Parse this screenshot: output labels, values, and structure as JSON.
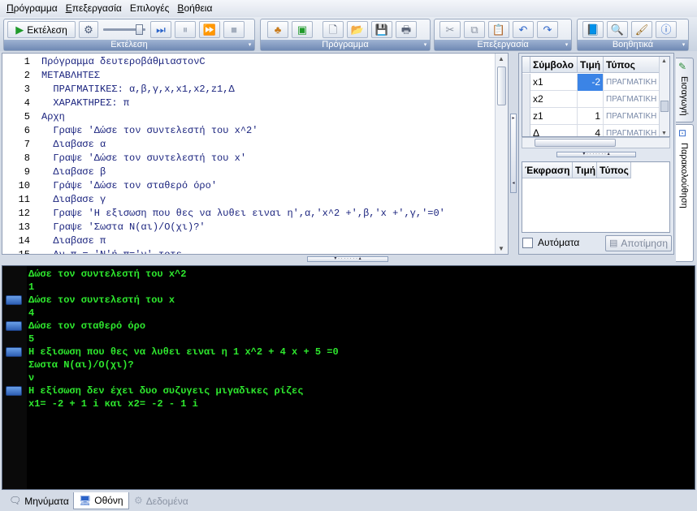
{
  "menu": {
    "items": [
      {
        "u": "Π",
        "rest": "ρόγραμμα"
      },
      {
        "u": "Ε",
        "rest": "πεξεργασία"
      },
      {
        "u": "",
        "rest": "Επιλογές",
        "u2": "λ"
      },
      {
        "u": "Β",
        "rest": "οήθεια"
      }
    ]
  },
  "toolbar": {
    "run_group": {
      "caption": "Εκτέλεση",
      "run_label": "Εκτέλεση"
    },
    "program_group": {
      "caption": "Πρόγραμμα"
    },
    "edit_group": {
      "caption": "Επεξεργασία"
    },
    "help_group": {
      "caption": "Βοηθητικά"
    }
  },
  "editor": {
    "lines": [
      {
        "n": "1",
        "text": "Πρόγραμμα δευτεροβάθμιαστονC"
      },
      {
        "n": "2",
        "text": "ΜΕΤΑΒΛΗΤΕΣ"
      },
      {
        "n": "3",
        "text": "  ΠΡΑΓΜΑΤΙΚΕΣ: α,β,γ,x,x1,x2,z1,Δ"
      },
      {
        "n": "4",
        "text": "  ΧΑΡΑΚΤΗΡΕΣ: π"
      },
      {
        "n": "5",
        "text": "Αρχη"
      },
      {
        "n": "6",
        "text": "  Γραψε 'Δώσε τον συντελεστή του x^2'"
      },
      {
        "n": "7",
        "text": "  Διαβασε α"
      },
      {
        "n": "8",
        "text": "  Γραψε 'Δώσε τον συντελεστή του x'"
      },
      {
        "n": "9",
        "text": "  Διαβασε β"
      },
      {
        "n": "10",
        "text": "  Γράψε 'Δώσε τον σταθερό όρο'"
      },
      {
        "n": "11",
        "text": "  Διαβασε γ"
      },
      {
        "n": "12",
        "text": "  Γραψε 'Η εξισωση που θες να λυθει ειναι η',α,'x^2 +',β,'x +',γ,'=0'"
      },
      {
        "n": "13",
        "text": "  Γραψε 'Σωστα Ν(αι)/Ο(χι)?'"
      },
      {
        "n": "14",
        "text": "  Διαβασε π"
      },
      {
        "n": "15",
        "text": "  Αν π = 'Ν'ή π='ν' τοτε"
      }
    ]
  },
  "symbols": {
    "headers": [
      "Σύμβολο",
      "Τιμή",
      "Τύπος"
    ],
    "rows": [
      {
        "name": "x1",
        "value": "-2",
        "type": "ΠΡΑΓΜΑΤΙΚΗ"
      },
      {
        "name": "x2",
        "value": "",
        "type": "ΠΡΑΓΜΑΤΙΚΗ"
      },
      {
        "name": "z1",
        "value": "1",
        "type": "ΠΡΑΓΜΑΤΙΚΗ"
      },
      {
        "name": "Δ",
        "value": "4",
        "type": "ΠΡΑΓΜΑΤΙΚΗ"
      }
    ]
  },
  "watch": {
    "headers": [
      "Έκφραση",
      "Τιμή",
      "Τύπος"
    ],
    "auto_label": "Αυτόματα",
    "store_label": "Αποτίμηση"
  },
  "vtabs": {
    "tab1": "Εισαγωγή",
    "tab2": "Παρακολούθηση"
  },
  "console": {
    "lines": [
      {
        "text": "Δώσε τον συντελεστή του x^2",
        "input": false
      },
      {
        "text": "1",
        "input": true
      },
      {
        "text": "Δώσε τον συντελεστή του x",
        "input": false
      },
      {
        "text": "4",
        "input": true
      },
      {
        "text": "Δώσε τον σταθερό όρο",
        "input": false
      },
      {
        "text": "5",
        "input": true
      },
      {
        "text": "Η εξισωση που θες να λυθει ειναι η 1 x^2 + 4 x + 5 =0",
        "input": false
      },
      {
        "text": "Σωστα Ν(αι)/Ο(χι)?",
        "input": false
      },
      {
        "text": "ν",
        "input": true
      },
      {
        "text": "Η εξίσωση δεν έχει δυο συζυγεις μιγαδικες ρίζες",
        "input": false
      },
      {
        "text": "x1= -2 + 1 i και x2= -2 - 1 i",
        "input": false
      }
    ]
  },
  "bottom_tabs": {
    "messages": "Μηνύματα",
    "screen": "Οθόνη",
    "data": "Δεδομένα"
  },
  "colors": {
    "console_text": "#2ee82e",
    "code_text": "#1a237e",
    "selection": "#3b84e6"
  }
}
